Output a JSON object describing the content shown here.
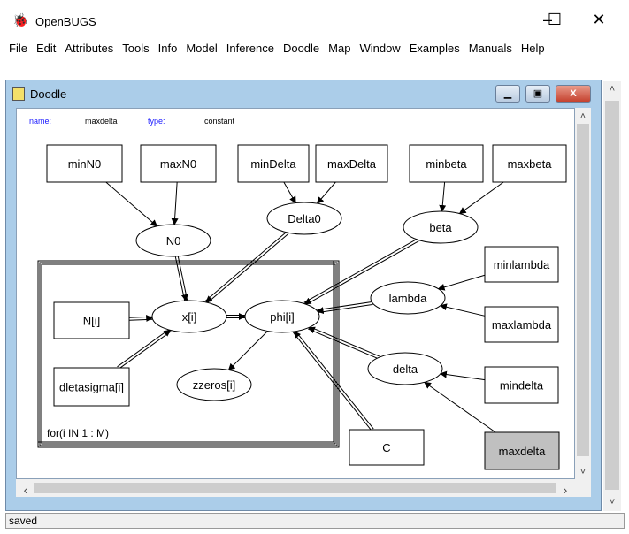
{
  "app": {
    "title": "OpenBUGS",
    "icon": "bug-icon",
    "minimize": "–",
    "maximize": "☐",
    "close": "✕"
  },
  "menu": [
    "File",
    "Edit",
    "Attributes",
    "Tools",
    "Info",
    "Model",
    "Inference",
    "Doodle",
    "Map",
    "Window",
    "Examples",
    "Manuals",
    "Help"
  ],
  "doodle": {
    "title": "Doodle",
    "icon": "doodle-document-icon",
    "info": {
      "name_label": "name:",
      "name_value": "maxdelta",
      "type_label": "type:",
      "type_value": "constant"
    },
    "plate_label": "for(i IN 1 : M)",
    "nodes": [
      {
        "id": "minN0",
        "label": "minN0",
        "shape": "rect"
      },
      {
        "id": "maxN0",
        "label": "maxN0",
        "shape": "rect"
      },
      {
        "id": "minDelta",
        "label": "minDelta",
        "shape": "rect"
      },
      {
        "id": "maxDelta",
        "label": "maxDelta",
        "shape": "rect"
      },
      {
        "id": "minbeta",
        "label": "minbeta",
        "shape": "rect"
      },
      {
        "id": "maxbeta",
        "label": "maxbeta",
        "shape": "rect"
      },
      {
        "id": "N0",
        "label": "N0",
        "shape": "ellipse"
      },
      {
        "id": "Delta0",
        "label": "Delta0",
        "shape": "ellipse"
      },
      {
        "id": "beta",
        "label": "beta",
        "shape": "ellipse"
      },
      {
        "id": "minlambda",
        "label": "minlambda",
        "shape": "rect"
      },
      {
        "id": "lambda",
        "label": "lambda",
        "shape": "ellipse"
      },
      {
        "id": "maxlambda",
        "label": "maxlambda",
        "shape": "rect"
      },
      {
        "id": "Ni",
        "label": "N[i]",
        "shape": "rect"
      },
      {
        "id": "xi",
        "label": "x[i]",
        "shape": "ellipse"
      },
      {
        "id": "phii",
        "label": "phi[i]",
        "shape": "ellipse"
      },
      {
        "id": "delta",
        "label": "delta",
        "shape": "ellipse"
      },
      {
        "id": "mindelta",
        "label": "mindelta",
        "shape": "rect"
      },
      {
        "id": "dletasigma",
        "label": "dletasigma[i]",
        "shape": "rect"
      },
      {
        "id": "zzeros",
        "label": "zzeros[i]",
        "shape": "ellipse"
      },
      {
        "id": "C",
        "label": "C",
        "shape": "rect"
      },
      {
        "id": "maxdelta",
        "label": "maxdelta",
        "shape": "rect",
        "selected": true
      }
    ],
    "edges": [
      {
        "from": "minN0",
        "to": "N0",
        "type": "stochastic"
      },
      {
        "from": "maxN0",
        "to": "N0",
        "type": "stochastic"
      },
      {
        "from": "minDelta",
        "to": "Delta0",
        "type": "stochastic"
      },
      {
        "from": "maxDelta",
        "to": "Delta0",
        "type": "stochastic"
      },
      {
        "from": "minbeta",
        "to": "beta",
        "type": "stochastic"
      },
      {
        "from": "maxbeta",
        "to": "beta",
        "type": "stochastic"
      },
      {
        "from": "N0",
        "to": "xi",
        "type": "logical"
      },
      {
        "from": "Delta0",
        "to": "xi",
        "type": "logical"
      },
      {
        "from": "Ni",
        "to": "xi",
        "type": "logical"
      },
      {
        "from": "dletasigma",
        "to": "xi",
        "type": "logical"
      },
      {
        "from": "xi",
        "to": "phii",
        "type": "logical"
      },
      {
        "from": "beta",
        "to": "phii",
        "type": "logical"
      },
      {
        "from": "lambda",
        "to": "phii",
        "type": "logical"
      },
      {
        "from": "delta",
        "to": "phii",
        "type": "logical"
      },
      {
        "from": "C",
        "to": "phii",
        "type": "logical"
      },
      {
        "from": "phii",
        "to": "zzeros",
        "type": "stochastic"
      },
      {
        "from": "minlambda",
        "to": "lambda",
        "type": "stochastic"
      },
      {
        "from": "maxlambda",
        "to": "lambda",
        "type": "stochastic"
      },
      {
        "from": "mindelta",
        "to": "delta",
        "type": "stochastic"
      },
      {
        "from": "maxdelta",
        "to": "delta",
        "type": "stochastic"
      }
    ]
  },
  "status": "saved",
  "colors": {
    "selected_node": "#c0c0c0",
    "info_label": "#1a1aff",
    "mdi_frame": "#abcde9",
    "close_button": "#d9534f"
  }
}
